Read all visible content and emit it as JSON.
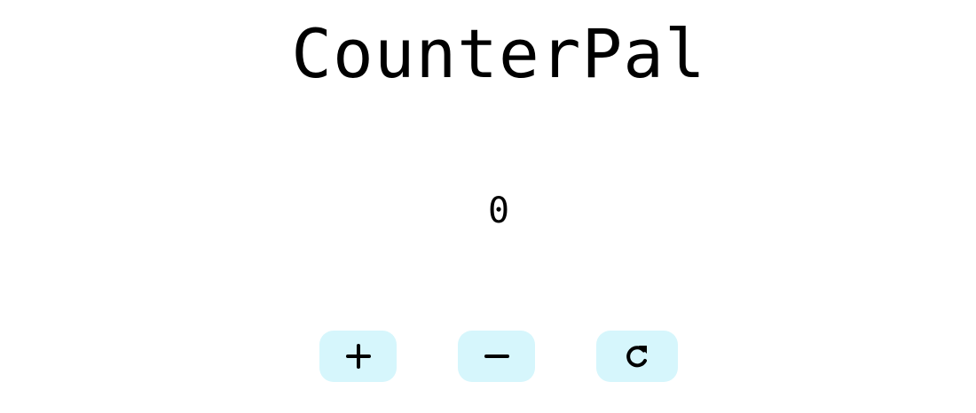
{
  "app": {
    "title": "CounterPal"
  },
  "counter": {
    "value": "0"
  },
  "controls": {
    "increment": {
      "icon": "plus-icon"
    },
    "decrement": {
      "icon": "minus-icon"
    },
    "reset": {
      "icon": "rotate-cw-icon"
    }
  },
  "colors": {
    "button_bg": "#d6f6fc",
    "text": "#000000",
    "background": "#ffffff"
  }
}
